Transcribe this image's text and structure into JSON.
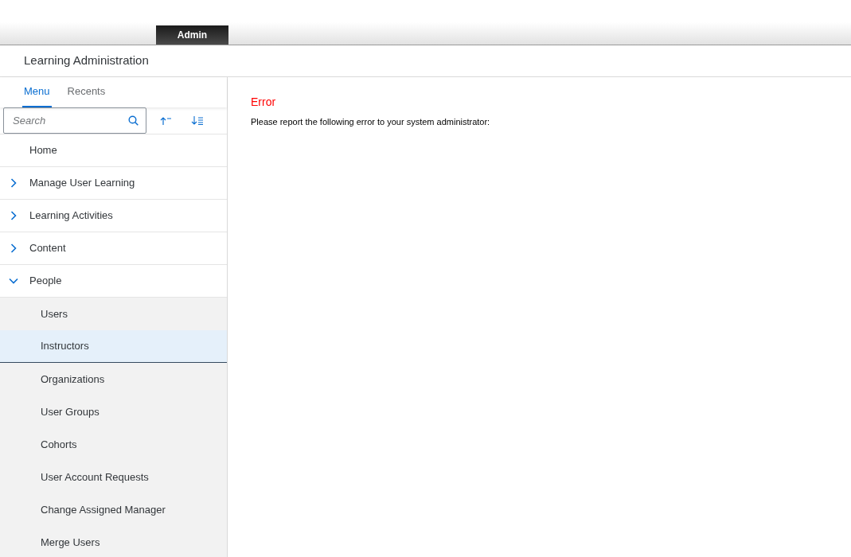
{
  "top_bar": {
    "tab": "Admin"
  },
  "header": {
    "title": "Learning Administration"
  },
  "sidebar": {
    "tabs": [
      {
        "label": "Menu",
        "selected": true
      },
      {
        "label": "Recents",
        "selected": false
      }
    ],
    "search": {
      "placeholder": "Search"
    },
    "items": [
      {
        "kind": "page",
        "label": "Home"
      },
      {
        "kind": "group",
        "label": "Manage User Learning",
        "expanded": false
      },
      {
        "kind": "group",
        "label": "Learning Activities",
        "expanded": false
      },
      {
        "kind": "group",
        "label": "Content",
        "expanded": false
      },
      {
        "kind": "group",
        "label": "People",
        "expanded": true,
        "children": [
          {
            "label": "Users",
            "selected": false
          },
          {
            "label": "Instructors",
            "selected": true
          },
          {
            "label": "Organizations",
            "selected": false
          },
          {
            "label": "User Groups",
            "selected": false
          },
          {
            "label": "Cohorts",
            "selected": false
          },
          {
            "label": "User Account Requests",
            "selected": false
          },
          {
            "label": "Change Assigned Manager",
            "selected": false
          },
          {
            "label": "Merge Users",
            "selected": false
          }
        ]
      }
    ]
  },
  "main": {
    "title": "Error",
    "message": "Please report the following error to your system administrator:"
  }
}
